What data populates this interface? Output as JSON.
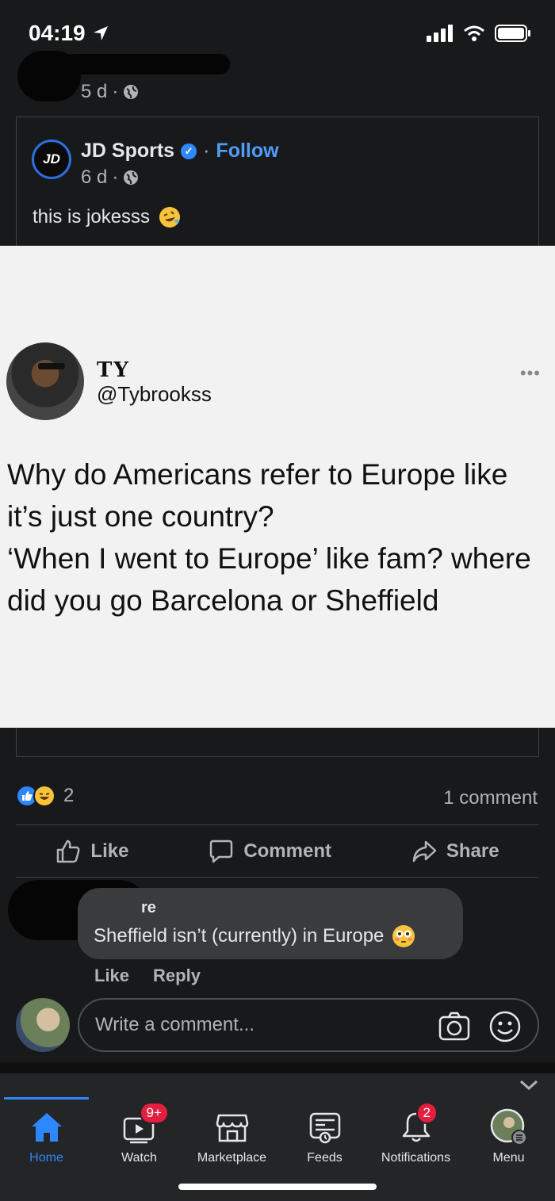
{
  "status_bar": {
    "time": "04:19"
  },
  "sharer": {
    "time_ago": "5 d",
    "separator": "·"
  },
  "shared_post": {
    "page_name": "JD Sports",
    "page_logo_text": "JD",
    "separator": "·",
    "follow_label": "Follow",
    "time_ago": "6 d",
    "text": "this is jokesss",
    "tweet": {
      "name": "TY",
      "handle": "@Tybrookss",
      "more": "•••",
      "body": "Why do Americans refer to Europe like it’s just one country?\n‘When I went to Europe’ like fam? where did you go Barcelona or Sheffield"
    }
  },
  "engagement": {
    "reaction_count": "2",
    "comment_count": "1 comment"
  },
  "actions": {
    "like": "Like",
    "comment": "Comment",
    "share": "Share"
  },
  "comment": {
    "author_partial": "re",
    "text": "Sheffield isn’t (currently) in Europe",
    "like": "Like",
    "reply": "Reply"
  },
  "composer": {
    "placeholder": "Write a comment..."
  },
  "tab_bar": {
    "items": [
      {
        "label": "Home",
        "icon": "home-icon",
        "active": true
      },
      {
        "label": "Watch",
        "icon": "watch-icon",
        "badge": "9+"
      },
      {
        "label": "Marketplace",
        "icon": "marketplace-icon"
      },
      {
        "label": "Feeds",
        "icon": "feeds-icon"
      },
      {
        "label": "Notifications",
        "icon": "bell-icon",
        "badge": "2"
      },
      {
        "label": "Menu",
        "icon": "menu-avatar-icon"
      }
    ]
  },
  "colors": {
    "accent": "#2d88ff",
    "background": "#18191a",
    "badge": "#e41e3f",
    "follow": "#4f9cf9"
  }
}
